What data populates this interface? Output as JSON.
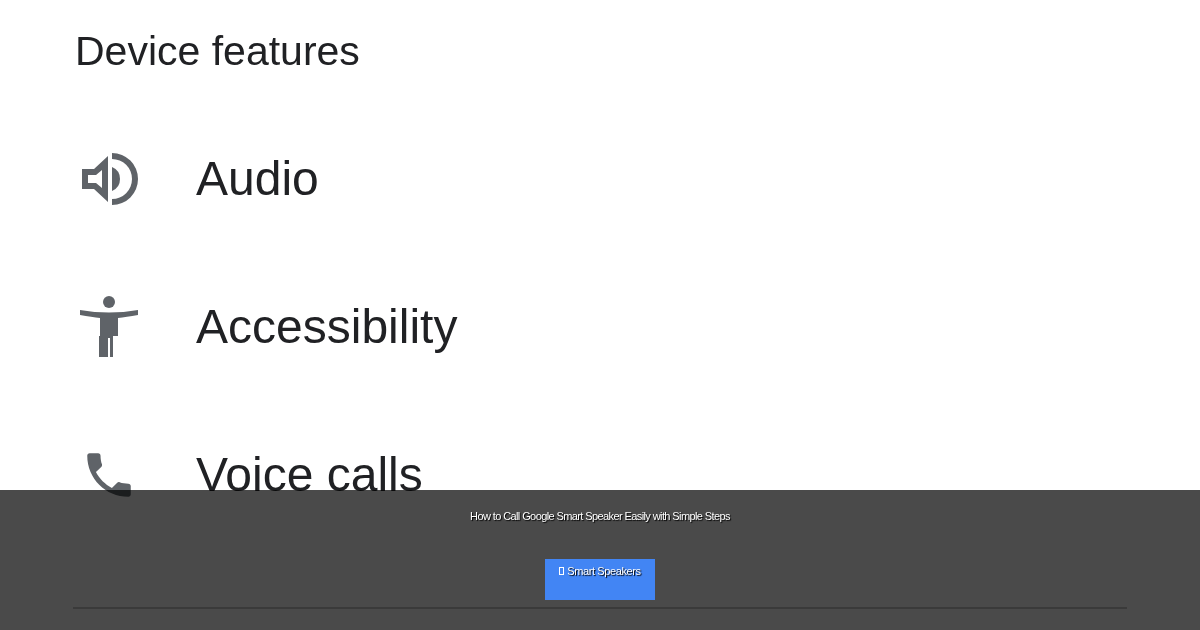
{
  "title": "Device features",
  "features": [
    {
      "kind": "speaker",
      "label": "Audio"
    },
    {
      "kind": "accessibility",
      "label": "Accessibility"
    },
    {
      "kind": "phone",
      "label": "Voice calls"
    }
  ],
  "overlay": {
    "headline": "How to Call Google Smart Speaker Easily with Simple Steps",
    "category": "Smart Speakers"
  }
}
